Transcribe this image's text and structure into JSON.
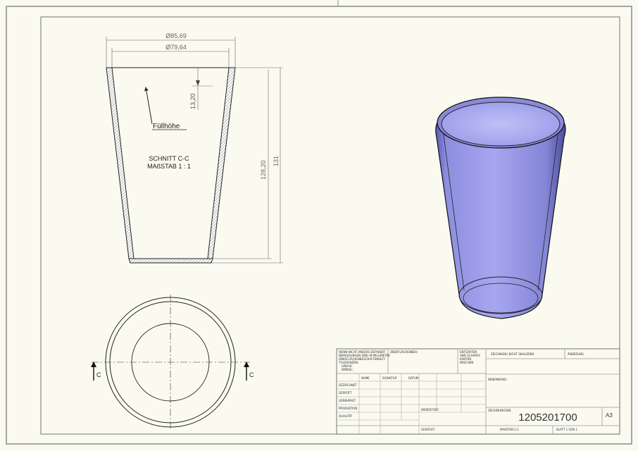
{
  "section": {
    "outer_diameter": "Ø85,69",
    "inner_diameter": "Ø79,64",
    "fill_offset": "13,20",
    "fill_label": "Füllhöhe",
    "inner_height": "128,20",
    "total_height": "131",
    "title_line1": "SCHNITT C-C",
    "title_line2": "MAßSTAB 1 : 1"
  },
  "plan": {
    "cut_left": "C",
    "cut_right": "C"
  },
  "title_block": {
    "note1": "WENN NICHT ANDERS DEFINIERT:",
    "note2": "BEMASSUNGEN SIND IN MILLIMETER",
    "note3": "OBERFLÄCHENBESCHAFFENHEIT:",
    "note4": "TOLERANZEN:",
    "note5": "LINEAR:",
    "note6": "WINKEL:",
    "finish": "OBERFLÄCHENBEH.:",
    "deburr1": "ENTGRATEN",
    "deburr2": "UND SCHARFE",
    "deburr3": "KANTEN",
    "deburr4": "BRECHEN",
    "no_scale": "ZEICHNUNG NICHT SKALIEREN",
    "revision": "ÄNDERUNG",
    "col_name": "NAME",
    "col_sign": "SIGNATUR",
    "col_date": "DATUM",
    "row_drawn": "GEZEICHNET",
    "row_checked": "GEPRÜFT",
    "row_approved": "GENEHMIGT",
    "row_production": "PRODUKTION",
    "row_quality": "QUALITÄT",
    "benennung": "BENENNUNG:",
    "material": "WERKSTOFF:",
    "weight": "GEWICHT:",
    "drawing_no_label": "ZEICHNUNGSNR.",
    "drawing_no": "1205201700",
    "scale": "MAßSTAB:1:2",
    "sheet": "BLATT 1 VON 1",
    "format": "A3"
  }
}
